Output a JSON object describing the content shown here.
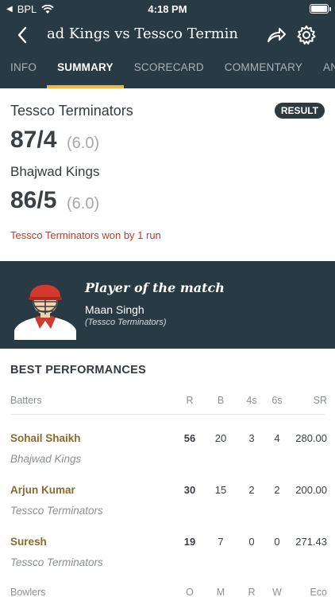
{
  "status_bar": {
    "back_app": "BPL",
    "time": "4:18 PM"
  },
  "header": {
    "title": "Bhajwad Kings vs Tessco Terminators",
    "visible_title": "ad Kings vs Tessco Termin"
  },
  "tabs": [
    {
      "label": "INFO",
      "active": false
    },
    {
      "label": "SUMMARY",
      "active": true
    },
    {
      "label": "SCORECARD",
      "active": false
    },
    {
      "label": "COMMENTARY",
      "active": false
    },
    {
      "label": "ANALYSIS",
      "active": false
    }
  ],
  "result": {
    "badge": "RESULT",
    "team1": {
      "name": "Tessco Terminators",
      "score": "87/4",
      "overs": "(6.0)"
    },
    "team2": {
      "name": "Bhajwad Kings",
      "score": "86/5",
      "overs": "(6.0)"
    },
    "summary": "Tessco Terminators won by 1 run"
  },
  "player_of_match": {
    "heading": "Player of the match",
    "name": "Maan Singh",
    "team": "(Tessco Terminators)"
  },
  "performances": {
    "title": "BEST PERFORMANCES",
    "batters_header": {
      "label": "Batters",
      "cols": [
        "R",
        "B",
        "4s",
        "6s",
        "SR"
      ]
    },
    "batters": [
      {
        "name": "Sohail Shaikh",
        "team": "Bhajwad Kings",
        "r": "56",
        "b": "20",
        "fours": "3",
        "sixes": "4",
        "sr": "280.00"
      },
      {
        "name": "Arjun Kumar",
        "team": "Tessco Terminators",
        "r": "30",
        "b": "15",
        "fours": "2",
        "sixes": "2",
        "sr": "200.00"
      },
      {
        "name": "Suresh",
        "team": "Tessco Terminators",
        "r": "19",
        "b": "7",
        "fours": "0",
        "sixes": "0",
        "sr": "271.43"
      }
    ],
    "bowlers_header": {
      "label": "Bowlers",
      "cols": [
        "O",
        "M",
        "R",
        "W",
        "Eco"
      ]
    }
  },
  "colors": {
    "header_bg": "#283a44",
    "active_tab_underline": "#f5b43a",
    "result_text": "#c0392b",
    "player_name": "#8a6a2e"
  }
}
